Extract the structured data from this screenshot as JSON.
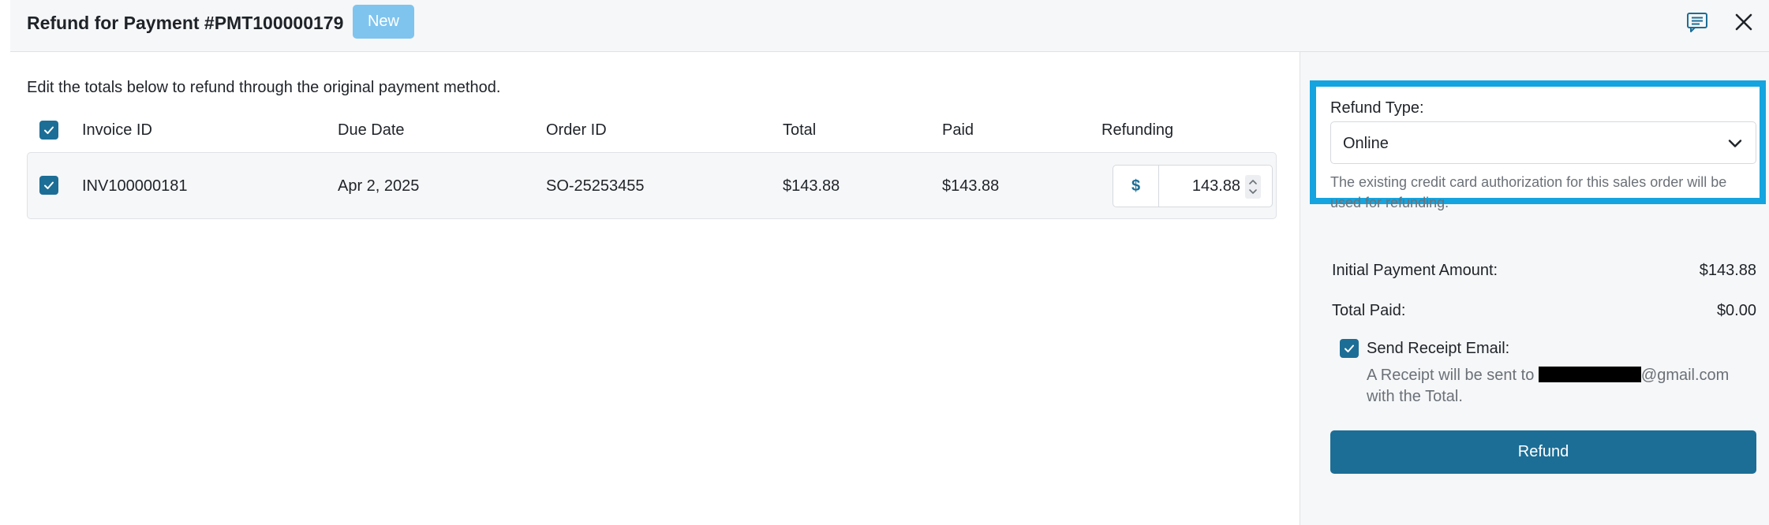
{
  "header": {
    "title": "Refund for Payment #PMT100000179",
    "badge": "New",
    "icons": [
      "comment-icon",
      "close-icon"
    ]
  },
  "main": {
    "instruction": "Edit the totals below to refund through the original payment method.",
    "columns": [
      "Invoice ID",
      "Due Date",
      "Order ID",
      "Total",
      "Paid",
      "Refunding"
    ],
    "rows": [
      {
        "invoice_id": "INV100000181",
        "due_date": "Apr 2, 2025",
        "order_id": "SO-25253455",
        "total": "$143.88",
        "paid": "$143.88",
        "currency_symbol": "$",
        "refunding": "143.88"
      }
    ]
  },
  "panel": {
    "refund_type_label": "Refund Type:",
    "refund_type_value": "Online",
    "refund_type_hint": "The existing credit card authorization for this sales order will be used for refunding.",
    "initial_payment_label": "Initial Payment Amount:",
    "initial_payment_value": "$143.88",
    "total_paid_label": "Total Paid:",
    "total_paid_value": "$0.00",
    "send_receipt_label": "Send Receipt Email:",
    "receipt_note_prefix": "A Receipt will be sent to",
    "receipt_note_suffix": "@gmail.com with the Total.",
    "refund_button": "Refund"
  },
  "colors": {
    "accent": "#1c6e96",
    "badge": "#7fc4ee",
    "highlight_border": "#14a4df"
  }
}
